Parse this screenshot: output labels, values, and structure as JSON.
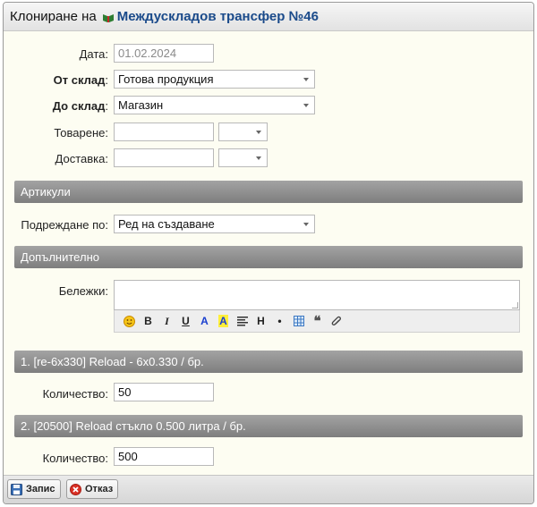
{
  "title": {
    "prefix": "Клониране на",
    "link": "Междускладов трансфер №46"
  },
  "form": {
    "date": {
      "label": "Дата:",
      "value": "01.02.2024"
    },
    "from_store": {
      "label": "От склад",
      "value": "Готова продукция"
    },
    "to_store": {
      "label": "До склад",
      "value": "Магазин"
    },
    "loading": {
      "label": "Товарене:",
      "value": "",
      "time": ""
    },
    "delivery": {
      "label": "Доставка:",
      "value": "",
      "time": ""
    }
  },
  "sections": {
    "articles": "Артикули",
    "additional": "Допълнително"
  },
  "order": {
    "label": "Подреждане по:",
    "value": "Ред на създаване"
  },
  "notes": {
    "label": "Бележки:",
    "value": "",
    "toolbar": [
      "emoji",
      "bold",
      "italic",
      "underline",
      "text-color",
      "background-color",
      "align",
      "heading",
      "list",
      "table",
      "quote",
      "attachment"
    ]
  },
  "items": [
    {
      "header": "1. [re-6x330] Reload - 6x0.330 / бр.",
      "qty_label": "Количество:",
      "qty": "50"
    },
    {
      "header": "2. [20500] Reload стъкло 0.500 литра / бр.",
      "qty_label": "Количество:",
      "qty": "500"
    }
  ],
  "buttons": {
    "save": "Запис",
    "cancel": "Отказ"
  },
  "colors": {
    "background": "#fdfdf2",
    "section_header": "#8f8f8f",
    "link": "#1a4a8a"
  }
}
